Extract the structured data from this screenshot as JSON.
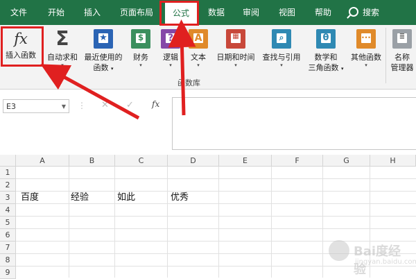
{
  "menu": {
    "tabs": [
      {
        "label": "文件"
      },
      {
        "label": "开始"
      },
      {
        "label": "插入"
      },
      {
        "label": "页面布局"
      },
      {
        "label": "公式",
        "active": true
      },
      {
        "label": "数据"
      },
      {
        "label": "审阅"
      },
      {
        "label": "视图"
      },
      {
        "label": "帮助"
      }
    ],
    "search_label": "搜索"
  },
  "ribbon": {
    "insert_function": {
      "line1": "插入函数",
      "icon": "fx-icon"
    },
    "autosum": {
      "line1": "自动求和",
      "caret": "▾",
      "icon": "sigma-icon"
    },
    "recently_used": {
      "line1": "最近使用的",
      "line2": "函数",
      "caret": "▾",
      "icon": "star-book-icon"
    },
    "financial": {
      "line1": "财务",
      "caret": "▾",
      "icon": "coins-book-icon"
    },
    "logical": {
      "line1": "逻辑",
      "caret": "▾",
      "icon": "question-book-icon"
    },
    "text": {
      "line1": "文本",
      "caret": "▾",
      "icon": "letter-a-book-icon"
    },
    "date_time": {
      "line1": "日期和时间",
      "caret": "▾",
      "icon": "calendar-book-icon"
    },
    "lookup": {
      "line1": "查找与引用",
      "caret": "▾",
      "icon": "magnifier-book-icon"
    },
    "math_trig": {
      "line1": "数学和",
      "line2": "三角函数",
      "caret": "▾",
      "icon": "theta-book-icon"
    },
    "more": {
      "line1": "其他函数",
      "caret": "▾",
      "icon": "ellipsis-book-icon"
    },
    "name_manager": {
      "line1": "名称",
      "line2": "管理器",
      "icon": "name-manager-icon"
    },
    "group_label": "函数库"
  },
  "formula_bar": {
    "name_box": "E3",
    "cancel": "✕",
    "enter": "✓",
    "fx": "fx"
  },
  "sheet": {
    "columns": [
      "A",
      "B",
      "C",
      "D",
      "E",
      "F",
      "G",
      "H"
    ],
    "rows": [
      "1",
      "2",
      "3",
      "4",
      "5",
      "6",
      "7",
      "8",
      "9"
    ],
    "cells": {
      "A3": "百度",
      "B3": "经验",
      "C3": "如此",
      "D3": "优秀"
    }
  },
  "watermark": {
    "text": "Bai度经验",
    "sub": "jingyan.baidu.com"
  },
  "colors": {
    "excel_green": "#217346",
    "annotation_red": "#e02020"
  }
}
